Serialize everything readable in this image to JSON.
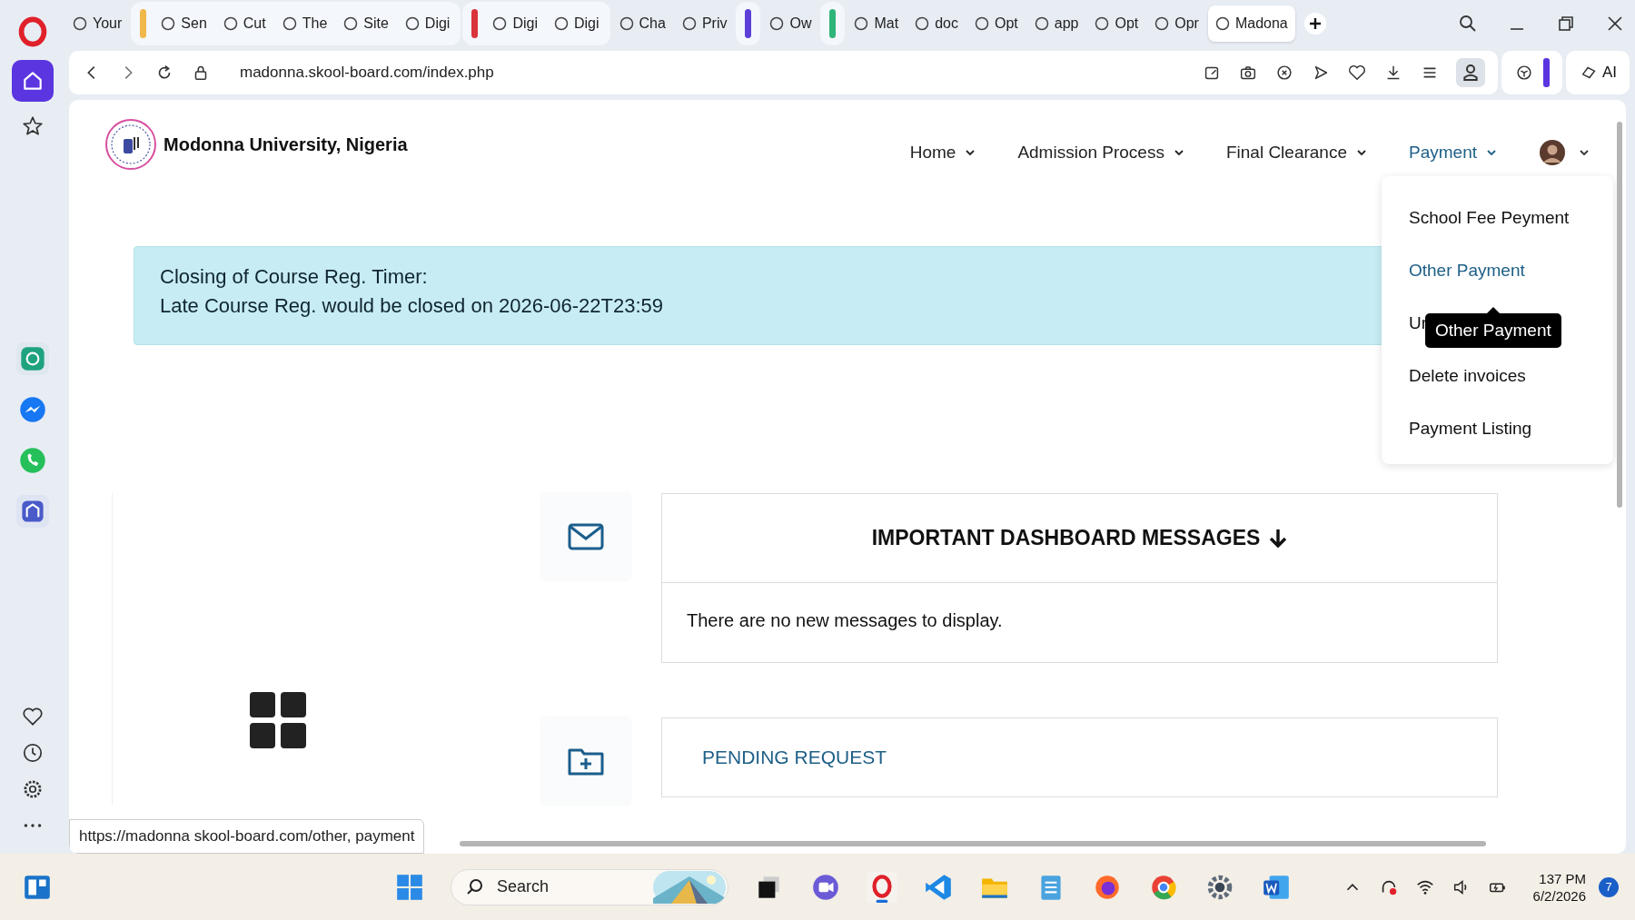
{
  "browser": {
    "tab_strip": [
      {
        "kind": "tab",
        "label": "Your",
        "selected": false
      },
      {
        "kind": "group",
        "color": "#f0b84a",
        "tabs": [
          {
            "label": "Sen",
            "selected": false
          },
          {
            "label": "Cut",
            "selected": false
          },
          {
            "label": "The",
            "selected": false
          },
          {
            "label": "Site",
            "selected": false
          },
          {
            "label": "Digi",
            "selected": false
          }
        ]
      },
      {
        "kind": "group",
        "color": "#d9343a",
        "tabs": [
          {
            "label": "Digi",
            "selected": false
          },
          {
            "label": "Digi",
            "selected": false
          }
        ]
      },
      {
        "kind": "tab",
        "label": "Cha",
        "selected": false
      },
      {
        "kind": "tab",
        "label": "Priv",
        "selected": false
      },
      {
        "kind": "group",
        "color": "#5b3fd6"
      },
      {
        "kind": "tab",
        "label": "Ow",
        "selected": false
      },
      {
        "kind": "group",
        "color": "#2fb57a"
      },
      {
        "kind": "tab",
        "label": "Mat",
        "selected": false
      },
      {
        "kind": "tab",
        "label": "doc",
        "selected": false
      },
      {
        "kind": "tab",
        "label": "Opt",
        "selected": false
      },
      {
        "kind": "tab",
        "label": "app",
        "selected": false
      },
      {
        "kind": "tab",
        "label": "Opt",
        "selected": false
      },
      {
        "kind": "tab",
        "label": "Opr",
        "selected": false
      },
      {
        "kind": "tab",
        "label": "Madona",
        "selected": true
      }
    ],
    "address": "madonna.skool-board.com/index.php",
    "ai_label": "AI",
    "sidebar": {
      "home": {
        "selected": true
      }
    },
    "status_url": "https://madonna skool-board.com/other, payment"
  },
  "site": {
    "name": "Modonna University, Nigeria",
    "nav": [
      {
        "label": "Home",
        "selected": false
      },
      {
        "label": "Admission Process",
        "selected": false
      },
      {
        "label": "Final Clearance",
        "selected": false
      },
      {
        "label": "Payment",
        "selected": true
      }
    ],
    "dropdown": [
      {
        "label": "School Fee Peyment",
        "selected": false
      },
      {
        "label": "Other Payment",
        "selected": true
      },
      {
        "label": "Ur",
        "selected": false
      },
      {
        "label": "Delete invoices",
        "selected": false
      },
      {
        "label": "Payment Listing",
        "selected": false
      }
    ],
    "tooltip": "Other Payment",
    "alert": [
      "Closing of Course Reg. Timer:",
      "Late Course Reg. would be closed on 2026-06-22T23:59"
    ],
    "messages": {
      "title": "IMPORTANT DASHBOARD MESSAGES",
      "body": "There are no new messages to display."
    },
    "pending": {
      "title": "PENDING REQUEST"
    }
  },
  "taskbar": {
    "search_placeholder": "Search",
    "time": "137 PM",
    "date": "6/2/2026",
    "notification_count": "7"
  }
}
